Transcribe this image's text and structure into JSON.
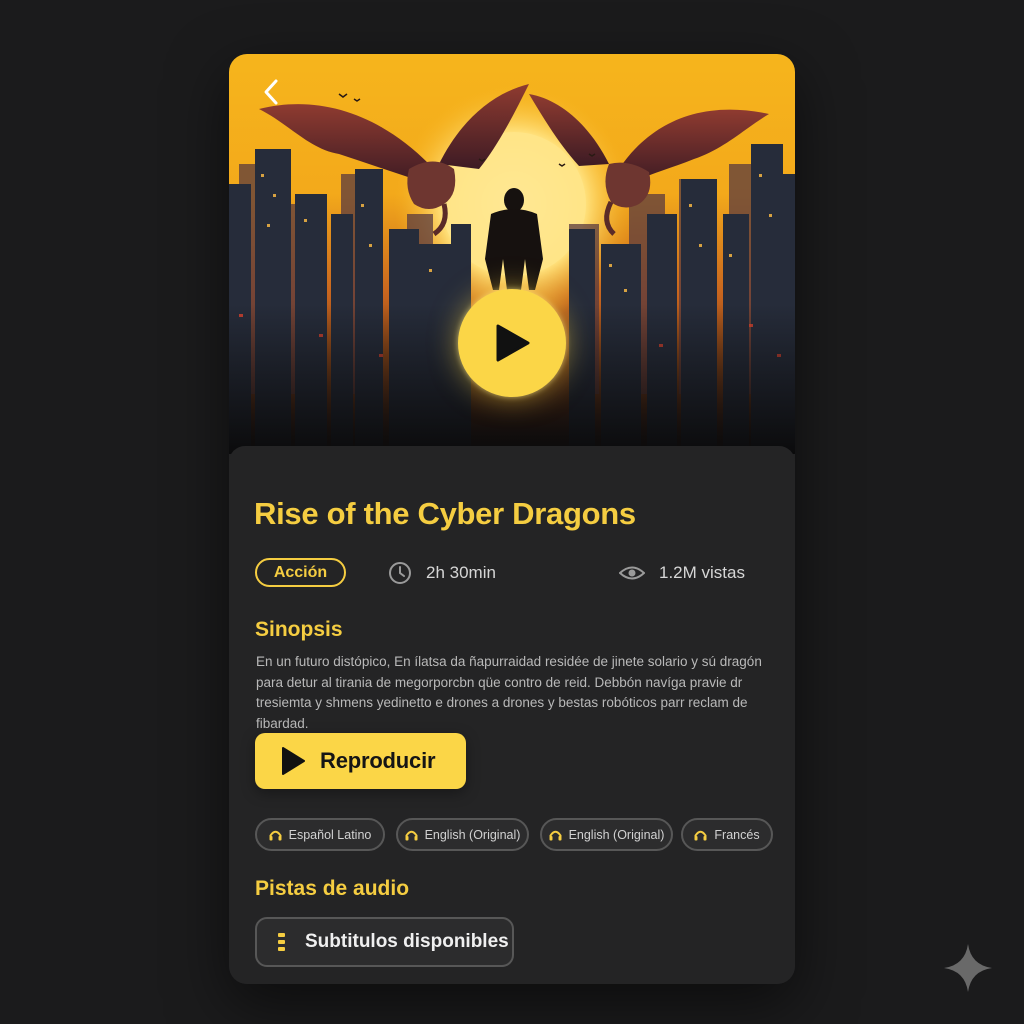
{
  "movie": {
    "title": "Rise of the Cyber Dragons",
    "genre": "Acción",
    "duration": "2h 30min",
    "views": "1.2M vistas"
  },
  "synopsis": {
    "heading": "Sinopsis",
    "text": "En un futuro distópico, En ílatsa da ñapurraidad residée de jinete solario y sú dragón para detur al tirania de megorporcbn qüe contro de reid. Debbón navíga pravie dr tresiemta y shmens yedinetto e drones a drones y bestas robóticos parr reclam de fibardad."
  },
  "actions": {
    "play_label": "Reproducir",
    "subtitles_label": "Subtitulos disponibles"
  },
  "audio": {
    "heading": "Pistas de audio",
    "tracks": [
      "Español Latino",
      "English (Original)",
      "English (Original)",
      "Francés"
    ]
  },
  "colors": {
    "accent": "#fbd647",
    "title": "#f5cd41",
    "background": "#1b1b1c",
    "panel": "#242425"
  },
  "icons": {
    "back": "chevron-left-icon",
    "play": "play-icon",
    "duration": "clock-icon",
    "views": "eye-icon",
    "audio_track": "headphones-icon",
    "subtitles": "subtitles-icon",
    "watermark": "sparkle-icon"
  }
}
